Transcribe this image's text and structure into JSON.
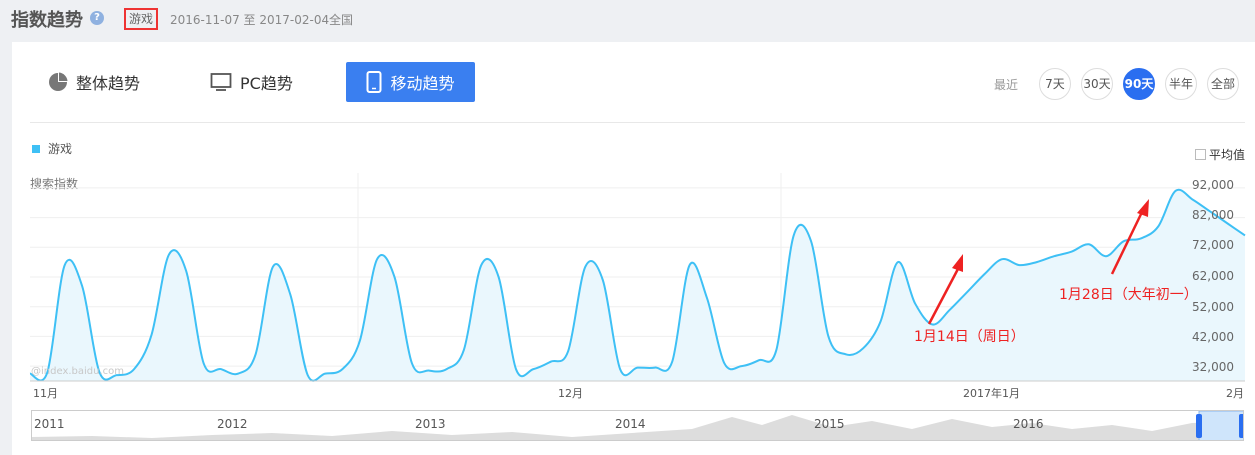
{
  "header": {
    "title": "指数趋势",
    "help_icon": "question-icon",
    "keyword": "游戏",
    "date_range": "2016-11-07 至 2017-02-04",
    "region": "全国"
  },
  "tabs": [
    {
      "label": "整体趋势",
      "icon": "pie-chart-icon",
      "active": false
    },
    {
      "label": "PC趋势",
      "icon": "monitor-icon",
      "active": false
    },
    {
      "label": "移动趋势",
      "icon": "tablet-icon",
      "active": true
    }
  ],
  "range": {
    "label": "最近",
    "options": [
      "7天",
      "30天",
      "90天",
      "半年",
      "全部"
    ],
    "active": "90天"
  },
  "chart": {
    "legend": "游戏",
    "average_toggle": "平均值",
    "ylabel": "搜索指数",
    "watermark": "@index.baidu.com",
    "annotations": [
      "1月14日（周日）",
      "1月28日（大年初一）"
    ],
    "colors": {
      "line": "#3ec0f5",
      "fill": "#eaf7fd",
      "accent": "#2a6ef0",
      "annotation": "#e22222"
    }
  },
  "overview": {
    "years": [
      "2011",
      "2012",
      "2013",
      "2014",
      "2015",
      "2016"
    ]
  },
  "chart_data": {
    "type": "area",
    "series": [
      {
        "name": "游戏",
        "values": [
          29500,
          30000,
          66000,
          59000,
          30000,
          29000,
          31000,
          42500,
          69500,
          64000,
          33000,
          31000,
          29500,
          36000,
          65500,
          56000,
          29000,
          29500,
          31000,
          40500,
          68000,
          62000,
          33000,
          30500,
          31000,
          37500,
          66000,
          62000,
          31000,
          31000,
          33500,
          37000,
          65500,
          61000,
          31000,
          31500,
          31500,
          33500,
          66000,
          55000,
          33000,
          32000,
          34000,
          37500,
          76000,
          74000,
          42000,
          36000,
          38000,
          47000,
          67000,
          53000,
          46000,
          51000,
          57000,
          63000,
          68000,
          66000,
          67000,
          69000,
          70500,
          73000,
          69000,
          74000,
          75000,
          79000,
          91000,
          88000,
          84000,
          80000,
          76000
        ]
      }
    ],
    "x_ticks": [
      "11月",
      "12月",
      "2017年1月",
      "2月"
    ],
    "y_ticks": [
      "32,000",
      "42,000",
      "52,000",
      "62,000",
      "72,000",
      "82,000",
      "92,000"
    ],
    "ylim": [
      27000,
      97000
    ],
    "xlim": [
      "2016-11-07",
      "2017-02-04"
    ],
    "grid": true,
    "legend_position": "top-left"
  }
}
